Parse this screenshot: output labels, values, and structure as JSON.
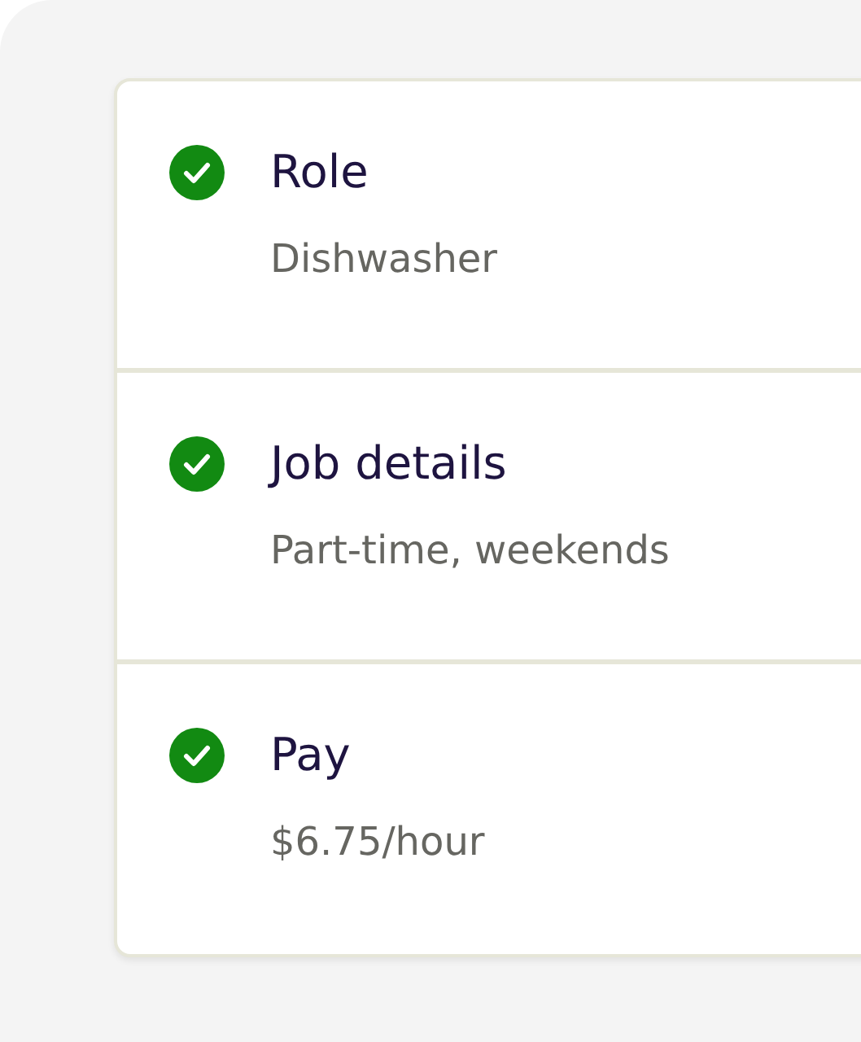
{
  "steps": [
    {
      "title": "Role",
      "value": "Dishwasher",
      "completed": true
    },
    {
      "title": "Job details",
      "value": "Part-time, weekends",
      "completed": true
    },
    {
      "title": "Pay",
      "value": "$6.75/hour",
      "completed": true
    }
  ]
}
